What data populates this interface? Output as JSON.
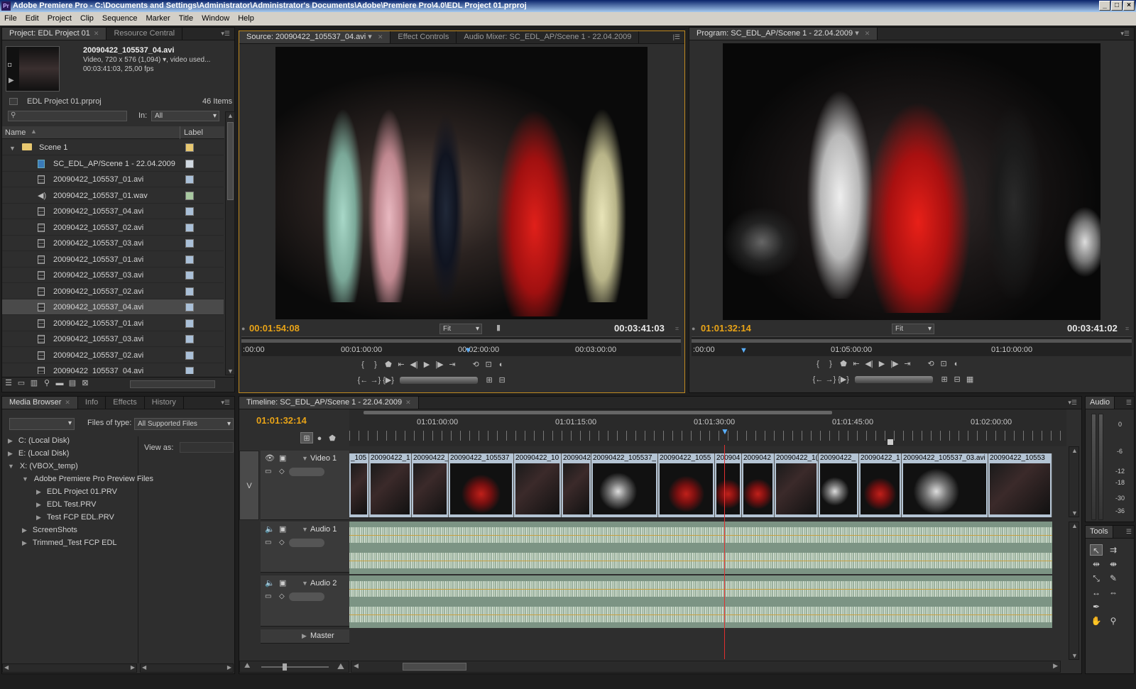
{
  "window": {
    "title": "Adobe Premiere Pro - C:\\Documents and Settings\\Administrator\\Administrator's Documents\\Adobe\\Premiere Pro\\4.0\\EDL Project 01.prproj",
    "logo": "Pr"
  },
  "menu": [
    "File",
    "Edit",
    "Project",
    "Clip",
    "Sequence",
    "Marker",
    "Title",
    "Window",
    "Help"
  ],
  "project": {
    "tabs": [
      "Project: EDL Project 01",
      "Resource Central"
    ],
    "clip_name": "20090422_105537_04.avi",
    "clip_info1": "Video, 720 x 576 (1,094)",
    "clip_info1_suffix": ", video used...",
    "clip_info2": "00:03:41:03, 25,00 fps",
    "project_file": "EDL Project 01.prproj",
    "item_count": "46 Items",
    "in_label": "In:",
    "in_value": "All",
    "col_name": "Name",
    "col_label": "Label",
    "items": [
      {
        "name": "Scene 1",
        "type": "folder",
        "label_color": "#e8c870"
      },
      {
        "name": "SC_EDL_AP/Scene 1 - 22.04.2009",
        "type": "sequence",
        "label_color": "#d0d8e0"
      },
      {
        "name": "20090422_105537_01.avi",
        "type": "video",
        "label_color": "#aac0d8"
      },
      {
        "name": "20090422_105537_01.wav",
        "type": "audio",
        "label_color": "#a8c8a0"
      },
      {
        "name": "20090422_105537_04.avi",
        "type": "video",
        "label_color": "#aac0d8"
      },
      {
        "name": "20090422_105537_02.avi",
        "type": "video",
        "label_color": "#aac0d8"
      },
      {
        "name": "20090422_105537_03.avi",
        "type": "video",
        "label_color": "#aac0d8"
      },
      {
        "name": "20090422_105537_01.avi",
        "type": "video",
        "label_color": "#aac0d8"
      },
      {
        "name": "20090422_105537_03.avi",
        "type": "video",
        "label_color": "#aac0d8"
      },
      {
        "name": "20090422_105537_02.avi",
        "type": "video",
        "label_color": "#aac0d8"
      },
      {
        "name": "20090422_105537_04.avi",
        "type": "video",
        "label_color": "#aac0d8",
        "selected": true
      },
      {
        "name": "20090422_105537_01.avi",
        "type": "video",
        "label_color": "#aac0d8"
      },
      {
        "name": "20090422_105537_03.avi",
        "type": "video",
        "label_color": "#aac0d8"
      },
      {
        "name": "20090422_105537_02.avi",
        "type": "video",
        "label_color": "#aac0d8"
      },
      {
        "name": "20090422_105537_04.avi",
        "type": "video",
        "label_color": "#aac0d8"
      }
    ]
  },
  "source": {
    "tabs": [
      "Source: 20090422_105537_04.avi",
      "Effect Controls",
      "Audio Mixer: SC_EDL_AP/Scene 1 - 22.04.2009"
    ],
    "current_tc": "00:01:54:08",
    "duration_tc": "00:03:41:03",
    "fit": "Fit",
    "ruler": [
      ":00:00",
      "00:01:00:00",
      "00:02:00:00",
      "00:03:00:00"
    ]
  },
  "program": {
    "tab": "Program: SC_EDL_AP/Scene 1 - 22.04.2009",
    "current_tc": "01:01:32:14",
    "duration_tc": "00:03:41:02",
    "fit": "Fit",
    "ruler": [
      ":00:00",
      "01:05:00:00",
      "01:10:00:00"
    ]
  },
  "media_browser": {
    "tabs": [
      "Media Browser",
      "Info",
      "Effects",
      "History"
    ],
    "files_of_type_label": "Files of type:",
    "files_of_type": "All Supported Files",
    "view_as": "View as:",
    "tree": [
      {
        "name": "C: (Local Disk)",
        "indent": 0,
        "arrow": "right"
      },
      {
        "name": "E: (Local Disk)",
        "indent": 0,
        "arrow": "right"
      },
      {
        "name": "X: (VBOX_temp)",
        "indent": 0,
        "arrow": "down"
      },
      {
        "name": "Adobe Premiere Pro Preview Files",
        "indent": 1,
        "arrow": "down"
      },
      {
        "name": "EDL Project 01.PRV",
        "indent": 2,
        "arrow": "right"
      },
      {
        "name": "EDL Test.PRV",
        "indent": 2,
        "arrow": "right"
      },
      {
        "name": "Test FCP EDL.PRV",
        "indent": 2,
        "arrow": "right"
      },
      {
        "name": "ScreenShots",
        "indent": 1,
        "arrow": "right"
      },
      {
        "name": "Trimmed_Test FCP EDL",
        "indent": 1,
        "arrow": "right"
      }
    ]
  },
  "timeline": {
    "tab": "Timeline: SC_EDL_AP/Scene 1 - 22.04.2009",
    "current_tc": "01:01:32:14",
    "ruler": [
      "01:01:00:00",
      "01:01:15:00",
      "01:01:30:00",
      "01:01:45:00",
      "01:02:00:00"
    ],
    "tracks": {
      "video1": "Video 1",
      "audio1": "Audio 1",
      "audio2": "Audio 2",
      "master": "Master",
      "v_label": "V"
    },
    "clips": [
      {
        "label": "_105",
        "thumb": "dark"
      },
      {
        "label": "20090422_1",
        "thumb": "dark"
      },
      {
        "label": "20090422_",
        "thumb": "dark"
      },
      {
        "label": "20090422_105537",
        "thumb": "red"
      },
      {
        "label": "20090422_10",
        "thumb": "dark"
      },
      {
        "label": "2009042",
        "thumb": "dark"
      },
      {
        "label": "20090422_105537_",
        "thumb": "white"
      },
      {
        "label": "20090422_1055",
        "thumb": "red"
      },
      {
        "label": "200904",
        "thumb": "red"
      },
      {
        "label": "2009042",
        "thumb": "red"
      },
      {
        "label": "20090422_1(",
        "thumb": "dark"
      },
      {
        "label": "20090422_",
        "thumb": "white"
      },
      {
        "label": "20090422_1",
        "thumb": "red"
      },
      {
        "label": "20090422_105537_03.avi",
        "thumb": "white"
      },
      {
        "label": "20090422_10553",
        "thumb": "dark"
      }
    ]
  },
  "audio_meter": {
    "title": "Audio",
    "scale": [
      "0",
      "-6",
      "-12",
      "-18",
      "-30",
      "-36"
    ]
  },
  "tools": {
    "title": "Tools"
  }
}
